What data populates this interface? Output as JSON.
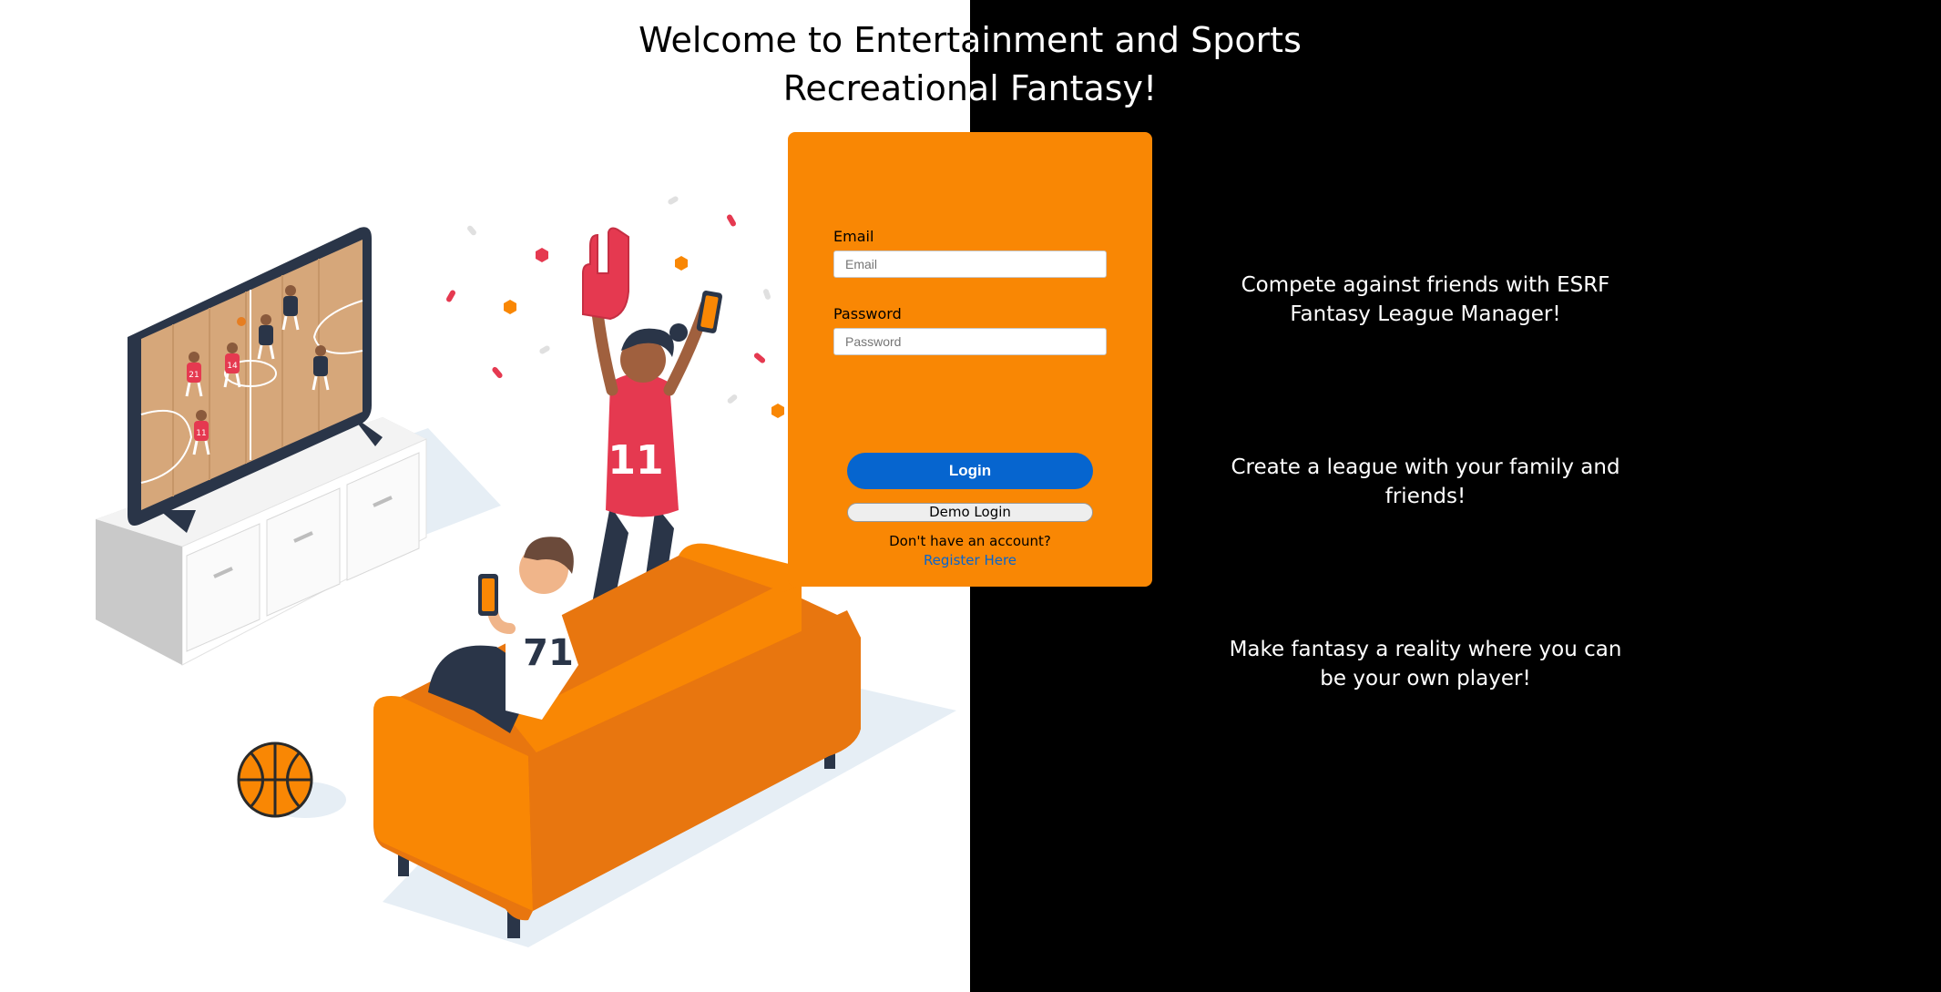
{
  "title": {
    "line1": "Welcome to Entertainment and Sports",
    "line2": "Recreational Fantasy!"
  },
  "login": {
    "email_label": "Email",
    "email_placeholder": "Email",
    "email_value": "",
    "password_label": "Password",
    "password_placeholder": "Password",
    "password_value": "",
    "login_button": "Login",
    "demo_button": "Demo Login",
    "no_account_text": "Don't have an account?",
    "register_link": "Register Here"
  },
  "features": [
    "Compete against friends with ESRF Fantasy League Manager!",
    "Create a league with your family and friends!",
    "Make fantasy a reality where you can be your own player!"
  ],
  "illustration": {
    "tv_player_numbers": [
      "21",
      "14",
      "11"
    ],
    "woman_jersey_number": "11",
    "man_jersey_number": "71"
  },
  "colors": {
    "card_orange": "#f98704",
    "login_blue": "#0665cf",
    "right_background": "#000000"
  }
}
